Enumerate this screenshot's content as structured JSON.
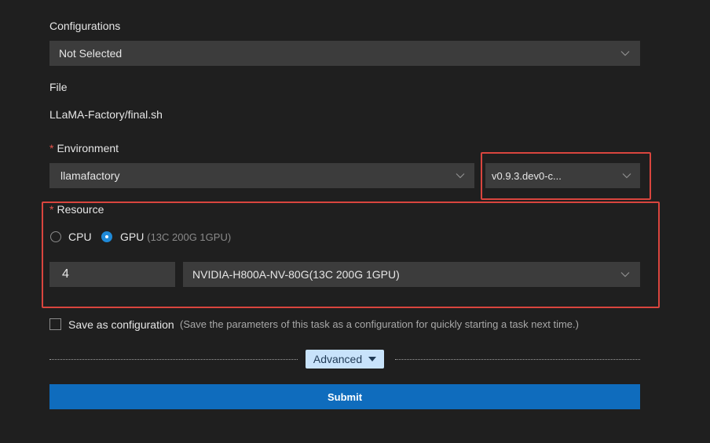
{
  "configurations": {
    "label": "Configurations",
    "selected": "Not Selected"
  },
  "file": {
    "label": "File",
    "value": "LLaMA-Factory/final.sh"
  },
  "environment": {
    "required_mark": "*",
    "label": "Environment",
    "image": "llamafactory",
    "version": "v0.9.3.dev0-c..."
  },
  "resource": {
    "required_mark": "*",
    "label": "Resource",
    "cpu_label": "CPU",
    "gpu_label": "GPU",
    "gpu_hint": "(13C 200G 1GPU)",
    "selected": "GPU",
    "count": "4",
    "spec": "NVIDIA-H800A-NV-80G(13C 200G 1GPU)"
  },
  "save_config": {
    "label": "Save as configuration",
    "hint": "(Save the parameters of this task as a configuration for quickly starting a task next time.)",
    "checked": false
  },
  "advanced": {
    "label": "Advanced",
    "icon": "caret-down-icon"
  },
  "submit": {
    "label": "Submit"
  },
  "colors": {
    "background": "#1f1f1f",
    "field": "#3c3c3c",
    "highlight": "#d9453e",
    "accent": "#0f6cbd",
    "radio_on": "#1f8ad8",
    "advanced_bg": "#c8e3fb"
  }
}
